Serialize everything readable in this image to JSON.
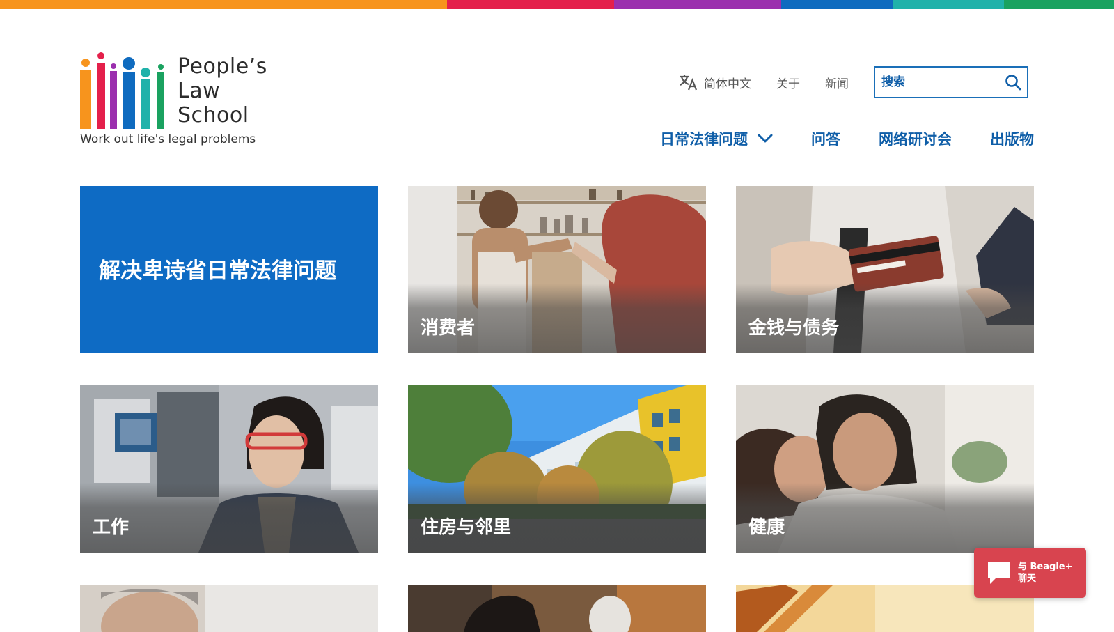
{
  "top_stripe_colors": [
    "#f7941d",
    "#e4204b",
    "#9b2fae",
    "#0f6bbf",
    "#20b2aa",
    "#1aa260"
  ],
  "logo": {
    "name_lines": [
      "People’s",
      "Law",
      "School"
    ],
    "tagline": "Work out life's legal problems",
    "bar_colors": [
      "#f7941d",
      "#e4204b",
      "#9b2fae",
      "#0f6bbf",
      "#20b2aa",
      "#1aa260"
    ]
  },
  "utility_nav": {
    "language_label": "简体中文",
    "language_icon": "translate-icon",
    "about_label": "关于",
    "news_label": "新闻",
    "search_placeholder": "搜索",
    "search_icon": "search-icon"
  },
  "main_nav": [
    {
      "label": "日常法律问题",
      "has_dropdown": true
    },
    {
      "label": "问答"
    },
    {
      "label": "网络研讨会"
    },
    {
      "label": "出版物"
    }
  ],
  "hero_card": {
    "text": "解决卑诗省日常法律问题",
    "color": "#0e6bc4"
  },
  "topic_cards": [
    {
      "label": "消费者"
    },
    {
      "label": "金钱与债务"
    },
    {
      "label": "工作"
    },
    {
      "label": "住房与邻里"
    },
    {
      "label": "健康"
    }
  ],
  "chat_widget": {
    "line1": "与 Beagle+",
    "line2": "聊天",
    "color": "#d8444f",
    "icon": "chat-bubble-icon"
  },
  "colors": {
    "link_blue": "#0f5ea8",
    "hero_blue": "#0e6bc4"
  }
}
